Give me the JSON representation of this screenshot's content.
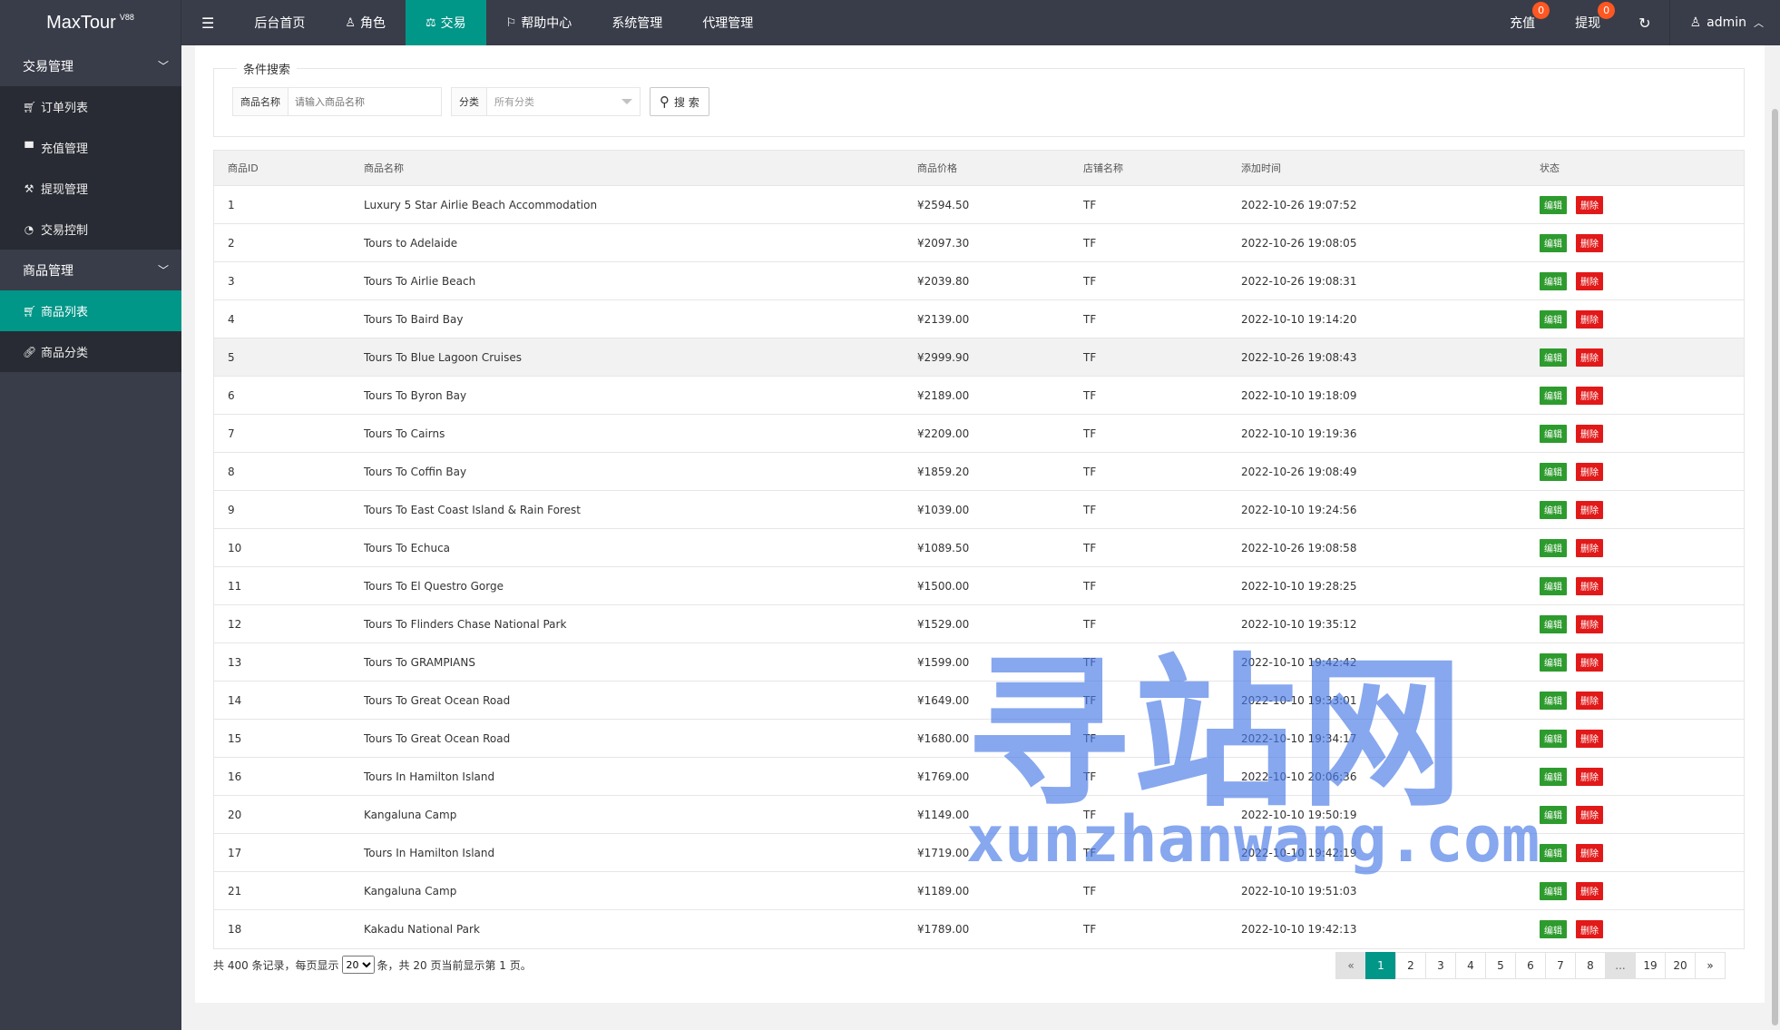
{
  "app": {
    "title": "MaxTour",
    "version": "V88"
  },
  "topnav": [
    {
      "label": "后台首页",
      "icon": ""
    },
    {
      "label": "角色",
      "icon": "user-icon"
    },
    {
      "label": "交易",
      "icon": "scale-icon",
      "active": true
    },
    {
      "label": "帮助中心",
      "icon": "flag-icon"
    },
    {
      "label": "系统管理",
      "icon": ""
    },
    {
      "label": "代理管理",
      "icon": ""
    }
  ],
  "right_nav": {
    "recharge": {
      "label": "充值",
      "badge": "0"
    },
    "withdraw": {
      "label": "提现",
      "badge": "0"
    },
    "user": "admin"
  },
  "sidebar": {
    "groups": [
      {
        "label": "交易管理",
        "items": [
          {
            "label": "订单列表",
            "icon": "cart-icon"
          },
          {
            "label": "充值管理",
            "icon": "comment-icon"
          },
          {
            "label": "提现管理",
            "icon": "gavel-icon"
          },
          {
            "label": "交易控制",
            "icon": "dashboard-icon"
          }
        ]
      },
      {
        "label": "商品管理",
        "items": [
          {
            "label": "商品列表",
            "icon": "cart-icon",
            "active": true
          },
          {
            "label": "商品分类",
            "icon": "link-icon"
          }
        ]
      }
    ]
  },
  "search": {
    "legend": "条件搜索",
    "name_label": "商品名称",
    "name_placeholder": "请输入商品名称",
    "category_label": "分类",
    "category_value": "所有分类",
    "button": "搜 索"
  },
  "table": {
    "headers": [
      "商品ID",
      "商品名称",
      "商品价格",
      "店铺名称",
      "添加时间",
      "状态"
    ],
    "edit_label": "编辑",
    "delete_label": "删除",
    "rows": [
      [
        "1",
        "Luxury 5 Star Airlie Beach Accommodation",
        "¥2594.50",
        "TF",
        "2022-10-26 19:07:52"
      ],
      [
        "2",
        "Tours to Adelaide",
        "¥2097.30",
        "TF",
        "2022-10-26 19:08:05"
      ],
      [
        "3",
        "Tours To Airlie Beach",
        "¥2039.80",
        "TF",
        "2022-10-26 19:08:31"
      ],
      [
        "4",
        "Tours To Baird Bay",
        "¥2139.00",
        "TF",
        "2022-10-10 19:14:20"
      ],
      [
        "5",
        "Tours To Blue Lagoon Cruises",
        "¥2999.90",
        "TF",
        "2022-10-26 19:08:43"
      ],
      [
        "6",
        "Tours To Byron Bay",
        "¥2189.00",
        "TF",
        "2022-10-10 19:18:09"
      ],
      [
        "7",
        "Tours To Cairns",
        "¥2209.00",
        "TF",
        "2022-10-10 19:19:36"
      ],
      [
        "8",
        "Tours To Coffin Bay",
        "¥1859.20",
        "TF",
        "2022-10-26 19:08:49"
      ],
      [
        "9",
        "Tours To East Coast Island & Rain Forest",
        "¥1039.00",
        "TF",
        "2022-10-10 19:24:56"
      ],
      [
        "10",
        "Tours To Echuca",
        "¥1089.50",
        "TF",
        "2022-10-26 19:08:58"
      ],
      [
        "11",
        "Tours To El Questro Gorge",
        "¥1500.00",
        "TF",
        "2022-10-10 19:28:25"
      ],
      [
        "12",
        "Tours To Flinders Chase National Park",
        "¥1529.00",
        "TF",
        "2022-10-10 19:35:12"
      ],
      [
        "13",
        "Tours To GRAMPIANS",
        "¥1599.00",
        "TF",
        "2022-10-10 19:42:42"
      ],
      [
        "14",
        "Tours To Great Ocean Road",
        "¥1649.00",
        "TF",
        "2022-10-10 19:33:01"
      ],
      [
        "15",
        "Tours To Great Ocean Road",
        "¥1680.00",
        "TF",
        "2022-10-10 19:34:17"
      ],
      [
        "16",
        "Tours In Hamilton Island",
        "¥1769.00",
        "TF",
        "2022-10-10 20:06:36"
      ],
      [
        "20",
        "Kangaluna Camp",
        "¥1149.00",
        "TF",
        "2022-10-10 19:50:19"
      ],
      [
        "17",
        "Tours In Hamilton Island",
        "¥1719.00",
        "TF",
        "2022-10-10 19:42:19"
      ],
      [
        "21",
        "Kangaluna Camp",
        "¥1189.00",
        "TF",
        "2022-10-10 19:51:03"
      ],
      [
        "18",
        "Kakadu National Park",
        "¥1789.00",
        "TF",
        "2022-10-10 19:42:13"
      ]
    ]
  },
  "footer": {
    "prefix": "共 400 条记录，每页显示",
    "page_size": "20",
    "suffix": "条，共 20 页当前显示第 1 页。"
  },
  "pager": [
    "«",
    "1",
    "2",
    "3",
    "4",
    "5",
    "6",
    "7",
    "8",
    "...",
    "19",
    "20",
    "»"
  ],
  "watermark": {
    "cn": "寻站网",
    "en": "xunzhanwang.com"
  },
  "colors": {
    "accent": "#009688",
    "dark": "#393d49",
    "edit": "#2e9b2e",
    "delete": "#e21919",
    "badge": "#ff5722"
  }
}
